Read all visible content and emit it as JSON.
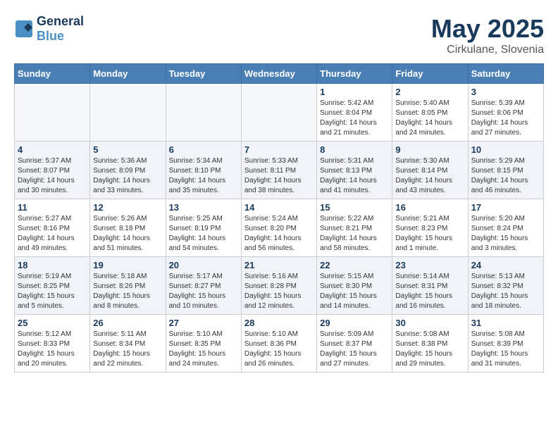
{
  "header": {
    "logo_line1": "General",
    "logo_line2": "Blue",
    "month": "May 2025",
    "location": "Cirkulane, Slovenia"
  },
  "days_of_week": [
    "Sunday",
    "Monday",
    "Tuesday",
    "Wednesday",
    "Thursday",
    "Friday",
    "Saturday"
  ],
  "weeks": [
    [
      {
        "day": "",
        "info": ""
      },
      {
        "day": "",
        "info": ""
      },
      {
        "day": "",
        "info": ""
      },
      {
        "day": "",
        "info": ""
      },
      {
        "day": "1",
        "info": "Sunrise: 5:42 AM\nSunset: 8:04 PM\nDaylight: 14 hours\nand 21 minutes."
      },
      {
        "day": "2",
        "info": "Sunrise: 5:40 AM\nSunset: 8:05 PM\nDaylight: 14 hours\nand 24 minutes."
      },
      {
        "day": "3",
        "info": "Sunrise: 5:39 AM\nSunset: 8:06 PM\nDaylight: 14 hours\nand 27 minutes."
      }
    ],
    [
      {
        "day": "4",
        "info": "Sunrise: 5:37 AM\nSunset: 8:07 PM\nDaylight: 14 hours\nand 30 minutes."
      },
      {
        "day": "5",
        "info": "Sunrise: 5:36 AM\nSunset: 8:09 PM\nDaylight: 14 hours\nand 33 minutes."
      },
      {
        "day": "6",
        "info": "Sunrise: 5:34 AM\nSunset: 8:10 PM\nDaylight: 14 hours\nand 35 minutes."
      },
      {
        "day": "7",
        "info": "Sunrise: 5:33 AM\nSunset: 8:11 PM\nDaylight: 14 hours\nand 38 minutes."
      },
      {
        "day": "8",
        "info": "Sunrise: 5:31 AM\nSunset: 8:13 PM\nDaylight: 14 hours\nand 41 minutes."
      },
      {
        "day": "9",
        "info": "Sunrise: 5:30 AM\nSunset: 8:14 PM\nDaylight: 14 hours\nand 43 minutes."
      },
      {
        "day": "10",
        "info": "Sunrise: 5:29 AM\nSunset: 8:15 PM\nDaylight: 14 hours\nand 46 minutes."
      }
    ],
    [
      {
        "day": "11",
        "info": "Sunrise: 5:27 AM\nSunset: 8:16 PM\nDaylight: 14 hours\nand 49 minutes."
      },
      {
        "day": "12",
        "info": "Sunrise: 5:26 AM\nSunset: 8:18 PM\nDaylight: 14 hours\nand 51 minutes."
      },
      {
        "day": "13",
        "info": "Sunrise: 5:25 AM\nSunset: 8:19 PM\nDaylight: 14 hours\nand 54 minutes."
      },
      {
        "day": "14",
        "info": "Sunrise: 5:24 AM\nSunset: 8:20 PM\nDaylight: 14 hours\nand 56 minutes."
      },
      {
        "day": "15",
        "info": "Sunrise: 5:22 AM\nSunset: 8:21 PM\nDaylight: 14 hours\nand 58 minutes."
      },
      {
        "day": "16",
        "info": "Sunrise: 5:21 AM\nSunset: 8:23 PM\nDaylight: 15 hours\nand 1 minute."
      },
      {
        "day": "17",
        "info": "Sunrise: 5:20 AM\nSunset: 8:24 PM\nDaylight: 15 hours\nand 3 minutes."
      }
    ],
    [
      {
        "day": "18",
        "info": "Sunrise: 5:19 AM\nSunset: 8:25 PM\nDaylight: 15 hours\nand 5 minutes."
      },
      {
        "day": "19",
        "info": "Sunrise: 5:18 AM\nSunset: 8:26 PM\nDaylight: 15 hours\nand 8 minutes."
      },
      {
        "day": "20",
        "info": "Sunrise: 5:17 AM\nSunset: 8:27 PM\nDaylight: 15 hours\nand 10 minutes."
      },
      {
        "day": "21",
        "info": "Sunrise: 5:16 AM\nSunset: 8:28 PM\nDaylight: 15 hours\nand 12 minutes."
      },
      {
        "day": "22",
        "info": "Sunrise: 5:15 AM\nSunset: 8:30 PM\nDaylight: 15 hours\nand 14 minutes."
      },
      {
        "day": "23",
        "info": "Sunrise: 5:14 AM\nSunset: 8:31 PM\nDaylight: 15 hours\nand 16 minutes."
      },
      {
        "day": "24",
        "info": "Sunrise: 5:13 AM\nSunset: 8:32 PM\nDaylight: 15 hours\nand 18 minutes."
      }
    ],
    [
      {
        "day": "25",
        "info": "Sunrise: 5:12 AM\nSunset: 8:33 PM\nDaylight: 15 hours\nand 20 minutes."
      },
      {
        "day": "26",
        "info": "Sunrise: 5:11 AM\nSunset: 8:34 PM\nDaylight: 15 hours\nand 22 minutes."
      },
      {
        "day": "27",
        "info": "Sunrise: 5:10 AM\nSunset: 8:35 PM\nDaylight: 15 hours\nand 24 minutes."
      },
      {
        "day": "28",
        "info": "Sunrise: 5:10 AM\nSunset: 8:36 PM\nDaylight: 15 hours\nand 26 minutes."
      },
      {
        "day": "29",
        "info": "Sunrise: 5:09 AM\nSunset: 8:37 PM\nDaylight: 15 hours\nand 27 minutes."
      },
      {
        "day": "30",
        "info": "Sunrise: 5:08 AM\nSunset: 8:38 PM\nDaylight: 15 hours\nand 29 minutes."
      },
      {
        "day": "31",
        "info": "Sunrise: 5:08 AM\nSunset: 8:39 PM\nDaylight: 15 hours\nand 31 minutes."
      }
    ]
  ]
}
